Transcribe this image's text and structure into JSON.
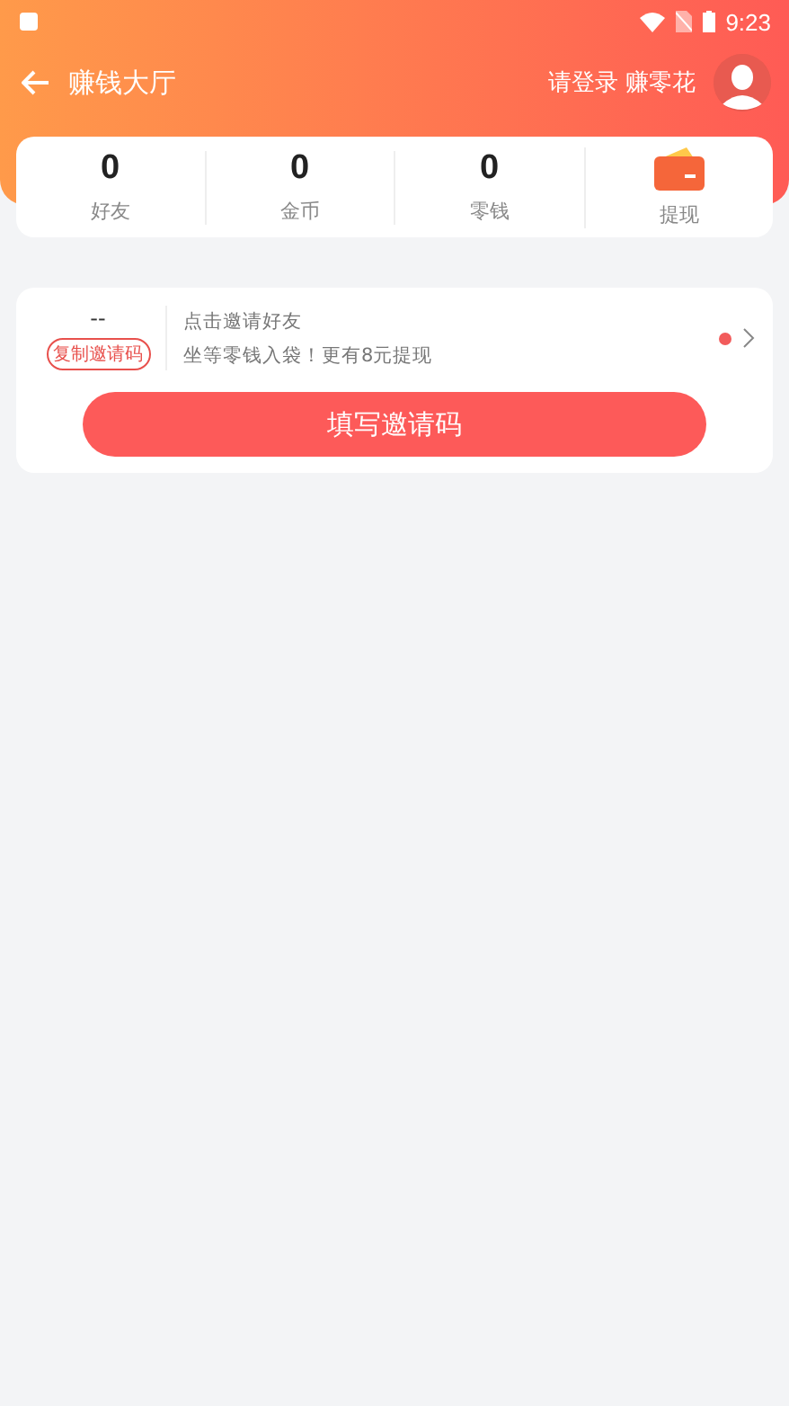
{
  "status_bar": {
    "time": "9:23"
  },
  "header": {
    "title": "赚钱大厅",
    "login_text": "请登录 赚零花"
  },
  "stats": [
    {
      "kind": "number",
      "value": "0",
      "label": "好友"
    },
    {
      "kind": "number",
      "value": "0",
      "label": "金币"
    },
    {
      "kind": "number",
      "value": "0",
      "label": "零钱"
    },
    {
      "kind": "wallet",
      "label": "提现"
    }
  ],
  "invite": {
    "code": "--",
    "copy_button": "复制邀请码",
    "line1": "点击邀请好友",
    "line2": "坐等零钱入袋！更有8元提现",
    "unread": true,
    "fill_button": "填写邀请码"
  }
}
